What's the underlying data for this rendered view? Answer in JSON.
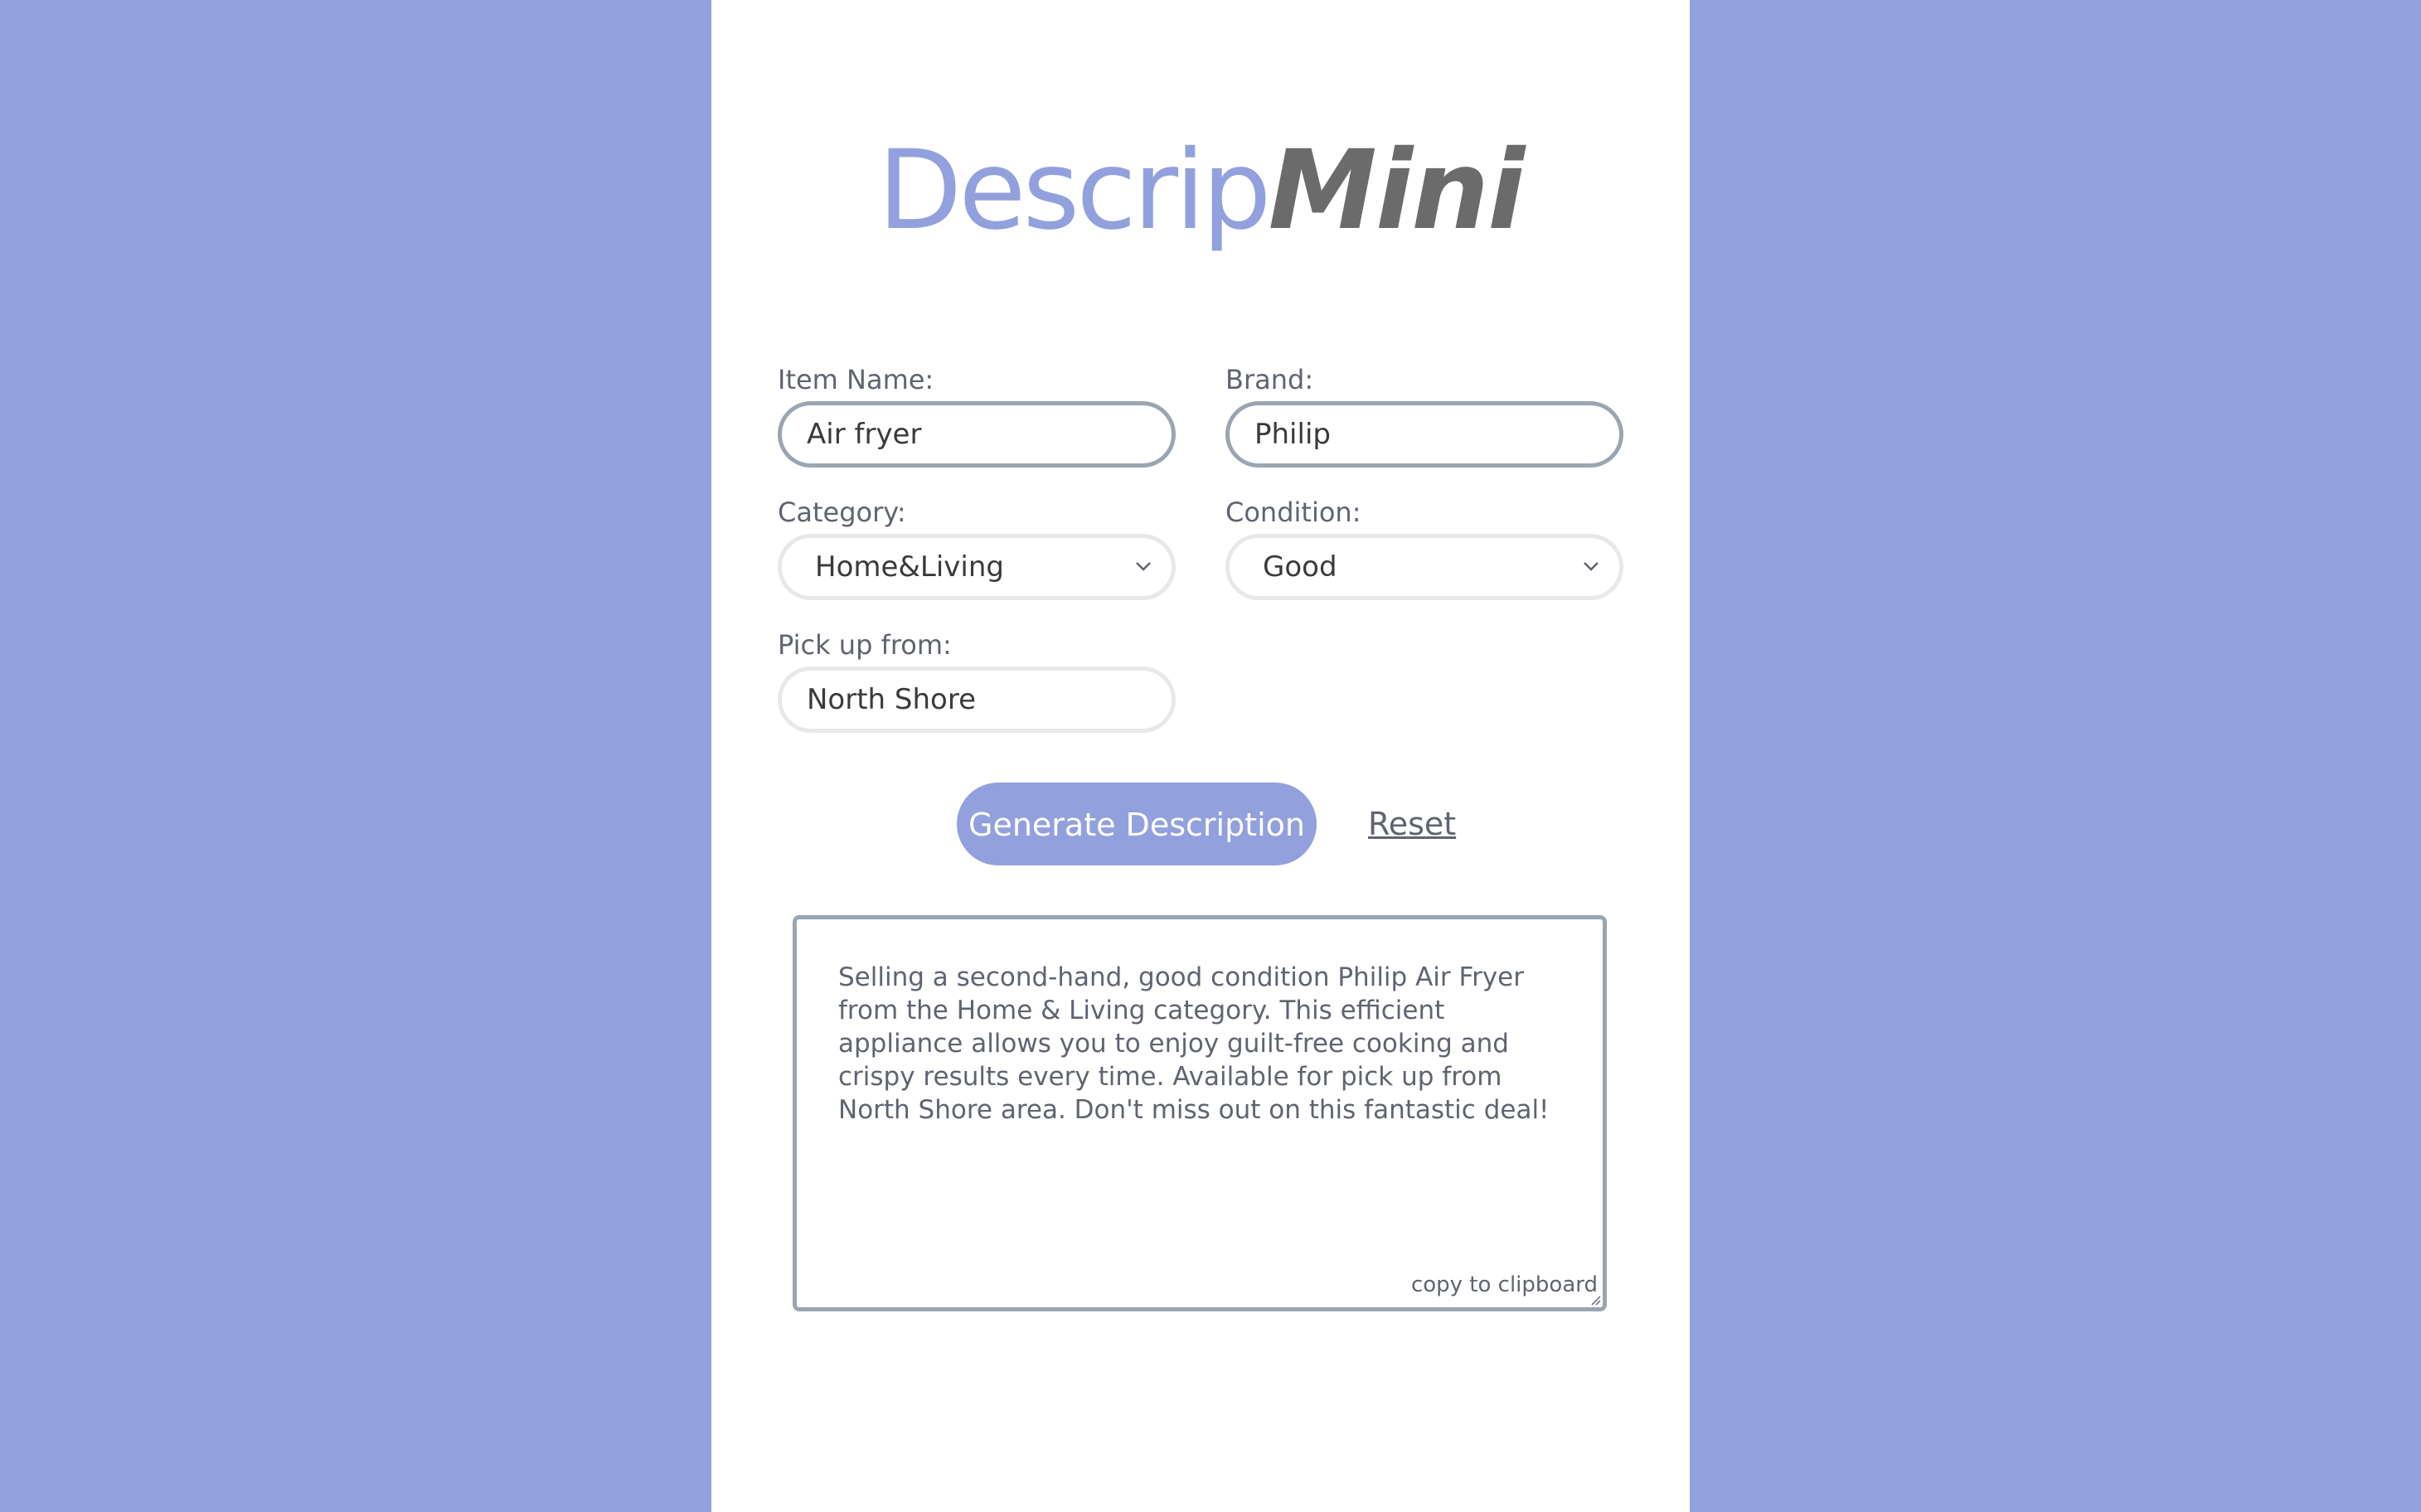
{
  "logo": {
    "part_light": "Descrip",
    "part_bold": "Mini"
  },
  "form": {
    "item_name": {
      "label": "Item Name:",
      "value": "Air fryer"
    },
    "brand": {
      "label": "Brand:",
      "value": "Philip"
    },
    "category": {
      "label": "Category:",
      "selected": "Home&Living"
    },
    "condition": {
      "label": "Condition:",
      "selected": "Good"
    },
    "pickup": {
      "label": "Pick up from:",
      "value": "North Shore"
    }
  },
  "actions": {
    "generate_label": "Generate Description",
    "reset_label": "Reset"
  },
  "output": {
    "text": "Selling a second-hand, good condition Philip Air Fryer from the Home & Living category. This efficient appliance allows you to enjoy guilt-free cooking and crispy results every time. Available for pick up from North Shore area. Don't miss out on this fantastic deal!",
    "copy_label": "copy to clipboard"
  },
  "colors": {
    "accent": "#92a1dd",
    "logo_dark": "#6b6b6b",
    "text": "#5f6470",
    "input_border": "#9aa5b3"
  }
}
